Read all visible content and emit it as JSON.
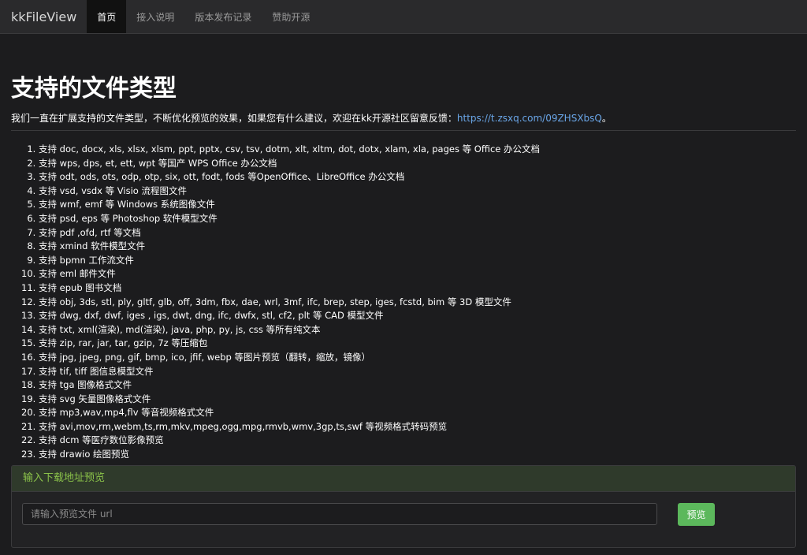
{
  "navbar": {
    "brand": "kkFileView",
    "items": [
      {
        "label": "首页"
      },
      {
        "label": "接入说明"
      },
      {
        "label": "版本发布记录"
      },
      {
        "label": "赞助开源"
      }
    ]
  },
  "main": {
    "title": "支持的文件类型",
    "subtitle_text": "我们一直在扩展支持的文件类型，不断优化预览的效果，如果您有什么建议，欢迎在kk开源社区留意反馈：",
    "subtitle_link": "https://t.zsxq.com/09ZHSXbsQ",
    "subtitle_end": "。",
    "file_types": [
      "支持 doc, docx, xls, xlsx, xlsm, ppt, pptx, csv, tsv, dotm, xlt, xltm, dot, dotx, xlam, xla, pages 等 Office 办公文档",
      "支持 wps, dps, et, ett, wpt 等国产 WPS Office 办公文档",
      "支持 odt, ods, ots, odp, otp, six, ott, fodt, fods 等OpenOffice、LibreOffice 办公文档",
      "支持 vsd, vsdx 等 Visio 流程图文件",
      "支持 wmf, emf 等 Windows 系统图像文件",
      "支持 psd, eps 等 Photoshop 软件模型文件",
      "支持 pdf ,ofd, rtf 等文档",
      "支持 xmind 软件模型文件",
      "支持 bpmn 工作流文件",
      "支持 eml 邮件文件",
      "支持 epub 图书文档",
      "支持 obj, 3ds, stl, ply, gltf, glb, off, 3dm, fbx, dae, wrl, 3mf, ifc, brep, step, iges, fcstd, bim 等 3D 模型文件",
      "支持 dwg, dxf, dwf, iges , igs, dwt, dng, ifc, dwfx, stl, cf2, plt 等 CAD 模型文件",
      "支持 txt, xml(渲染), md(渲染), java, php, py, js, css 等所有纯文本",
      "支持 zip, rar, jar, tar, gzip, 7z 等压缩包",
      "支持 jpg, jpeg, png, gif, bmp, ico, jfif, webp 等图片预览（翻转，缩放，镜像）",
      "支持 tif, tiff 图信息模型文件",
      "支持 tga 图像格式文件",
      "支持 svg 矢量图像格式文件",
      "支持 mp3,wav,mp4,flv 等音视频格式文件",
      "支持 avi,mov,rm,webm,ts,rm,mkv,mpeg,ogg,mpg,rmvb,wmv,3gp,ts,swf 等视频格式转码预览",
      "支持 dcm 等医疗数位影像预览",
      "支持 drawio 绘图预览"
    ]
  },
  "panel": {
    "heading": "输入下载地址预览",
    "input_placeholder": "请输入预览文件 url",
    "input_value": "",
    "button_label": "预览"
  }
}
